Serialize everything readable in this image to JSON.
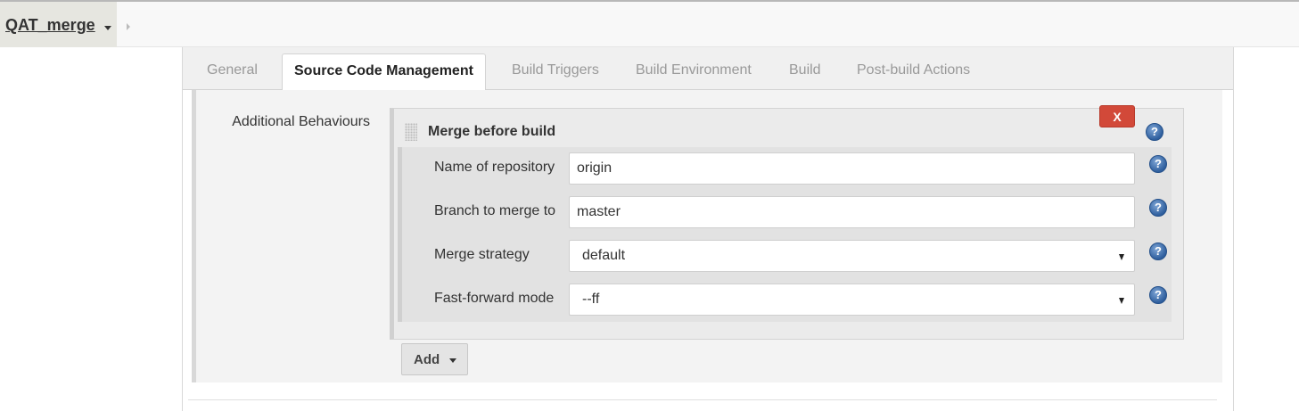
{
  "breadcrumb": {
    "job_name": "QAT_merge"
  },
  "tabs": [
    {
      "label": "General",
      "active": false
    },
    {
      "label": "Source Code Management",
      "active": true
    },
    {
      "label": "Build Triggers",
      "active": false
    },
    {
      "label": "Build Environment",
      "active": false
    },
    {
      "label": "Build",
      "active": false
    },
    {
      "label": "Post-build Actions",
      "active": false
    }
  ],
  "section": {
    "label": "Additional Behaviours"
  },
  "behaviour": {
    "title": "Merge before build",
    "delete_label": "X",
    "fields": [
      {
        "label": "Name of repository",
        "type": "text",
        "value": "origin"
      },
      {
        "label": "Branch to merge to",
        "type": "text",
        "value": "master"
      },
      {
        "label": "Merge strategy",
        "type": "select",
        "value": "default"
      },
      {
        "label": "Fast-forward mode",
        "type": "select",
        "value": "--ff"
      }
    ]
  },
  "add_button": {
    "label": "Add"
  },
  "help_icon_glyph": "?",
  "colors": {
    "delete_button": "#d24939",
    "help_icon": "#2f5f9e",
    "active_tab_text": "#222222",
    "inactive_tab_text": "#999999"
  }
}
